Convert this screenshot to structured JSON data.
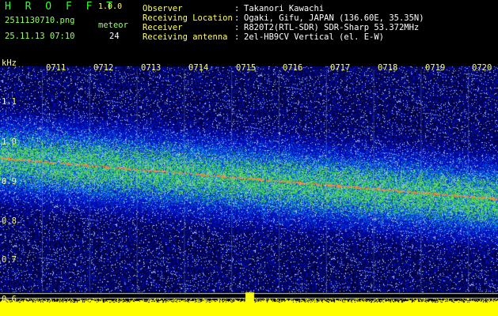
{
  "app": {
    "logo": "H R O F F T",
    "version": "1.0.0"
  },
  "file": {
    "name": "2511130710.png",
    "timestamp": "25.11.13 07:10"
  },
  "meteor": {
    "label": "meteor",
    "count": "24"
  },
  "info": [
    {
      "key": "Observer",
      "sep": ":",
      "value": "Takanori Kawachi"
    },
    {
      "key": "Receiving Location",
      "sep": ":",
      "value": "Ogaki, Gifu, JAPAN (136.60E, 35.35N)"
    },
    {
      "key": "Receiver",
      "sep": ":",
      "value": "R820T2(RTL-SDR) SDR-Sharp 53.372MHz"
    },
    {
      "key": "Receiving antenna",
      "sep": ":",
      "value": "2el-HB9CV Vertical (el. E-W)"
    }
  ],
  "axis": {
    "y_unit": "kHz",
    "y_ticks": [
      "1.1",
      "1.0",
      "0.9",
      "0.8",
      "0.7",
      "0.6"
    ],
    "x_ticks": [
      "0711",
      "0712",
      "0713",
      "0714",
      "0715",
      "0716",
      "0717",
      "0718",
      "0719",
      "0720"
    ]
  },
  "colors": {
    "header_green": "#99ff66",
    "header_yellow": "#ffff66",
    "signal_bar": "#ffff00",
    "waterfall_blue": "#1a3cff"
  }
}
